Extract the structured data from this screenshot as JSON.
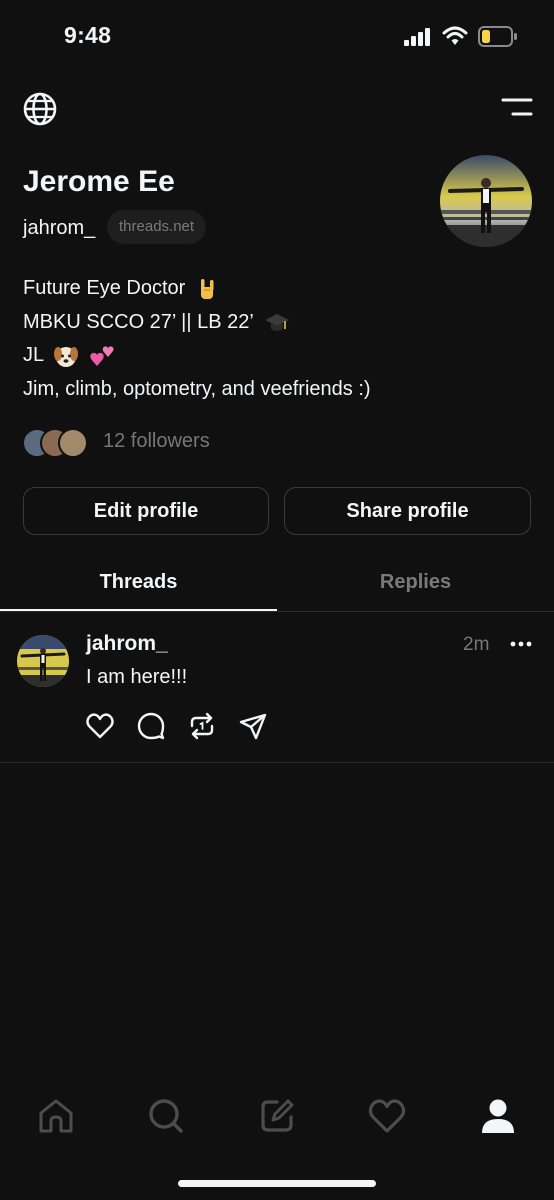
{
  "status_bar": {
    "time": "9:48"
  },
  "profile": {
    "name": "Jerome Ee",
    "handle": "jahrom_",
    "domain_badge": "threads.net",
    "bio": [
      "Future Eye Doctor",
      "MBKU SCCO 27’ || LB 22’",
      "JL",
      "Jim, climb, optometry, and veefriends :)"
    ],
    "followers": "12 followers"
  },
  "actions": {
    "edit": "Edit profile",
    "share": "Share profile"
  },
  "tabs": [
    {
      "label": "Threads",
      "active": true
    },
    {
      "label": "Replies",
      "active": false
    }
  ],
  "post": {
    "user": "jahrom_",
    "time": "2m",
    "text": "I am here!!!"
  },
  "icons": {
    "header": [
      "globe-icon",
      "menu-icon"
    ],
    "post_actions": [
      "heart-icon",
      "comment-icon",
      "repost-icon",
      "share-icon"
    ],
    "nav": [
      "home-icon",
      "search-icon",
      "compose-icon",
      "activity-heart-icon",
      "profile-icon"
    ]
  },
  "colors": {
    "background": "#101010",
    "text": "#f3f5f7",
    "muted": "#777777",
    "battery": "#f5d547"
  }
}
